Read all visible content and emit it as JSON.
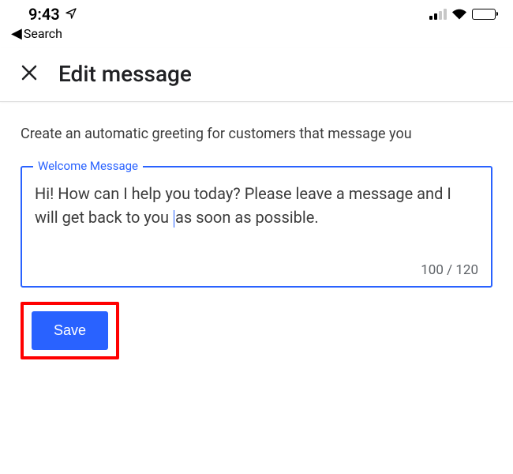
{
  "status": {
    "time": "9:43",
    "back_label": "Search"
  },
  "header": {
    "title": "Edit message"
  },
  "main": {
    "instruction": "Create an automatic greeting for customers that message you",
    "field_label": "Welcome Message",
    "message_before_cursor": "Hi! How can I help you today? Please leave a message and I will get back to you ",
    "message_after_cursor": "as soon as possible.",
    "char_count": "100 / 120",
    "save_label": "Save"
  }
}
